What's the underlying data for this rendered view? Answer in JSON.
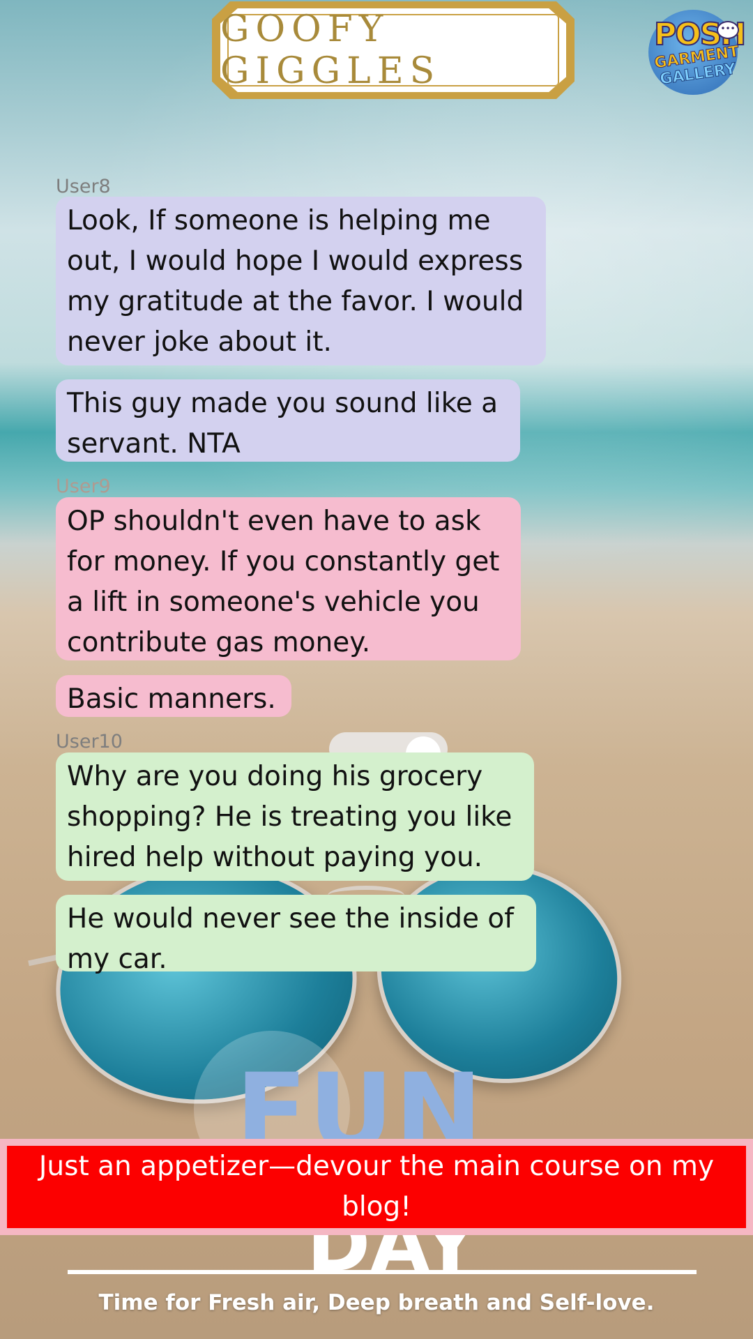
{
  "header": {
    "title": "GOOFY GIGGLES",
    "logo_line1": "POSH",
    "logo_line2": "GARMENT",
    "logo_line3": "GALLERY"
  },
  "chat": [
    {
      "user": "User8",
      "messages": [
        "Look, If someone is helping me\nout, I would hope I would express\nmy gratitude at the favor. I would\nnever joke about it.",
        "This guy made you sound like a\nservant. NTA"
      ]
    },
    {
      "user": "User9",
      "messages": [
        "OP shouldn't even have to ask\nfor money. If you constantly get\na lift in someone's vehicle you\ncontribute gas money.",
        "Basic manners."
      ]
    },
    {
      "user": "User10",
      "messages": [
        "Why are you doing his grocery\nshopping? He is treating you like\nhired help without paying you.",
        "He would never see the inside of\nmy car."
      ]
    }
  ],
  "background_text": {
    "fun": "FUN",
    "day": "DAY"
  },
  "cta": {
    "text": "Just an appetizer—devour the main course on my blog!"
  },
  "footer": {
    "tagline": "Time for Fresh air, Deep breath and Self-love."
  },
  "colors": {
    "user8_bubble": "#d3d1ef",
    "user9_bubble": "#f6bccf",
    "user10_bubble": "#d4f0cd",
    "cta_red": "#fc0000",
    "title_gold": "#c9a043"
  }
}
